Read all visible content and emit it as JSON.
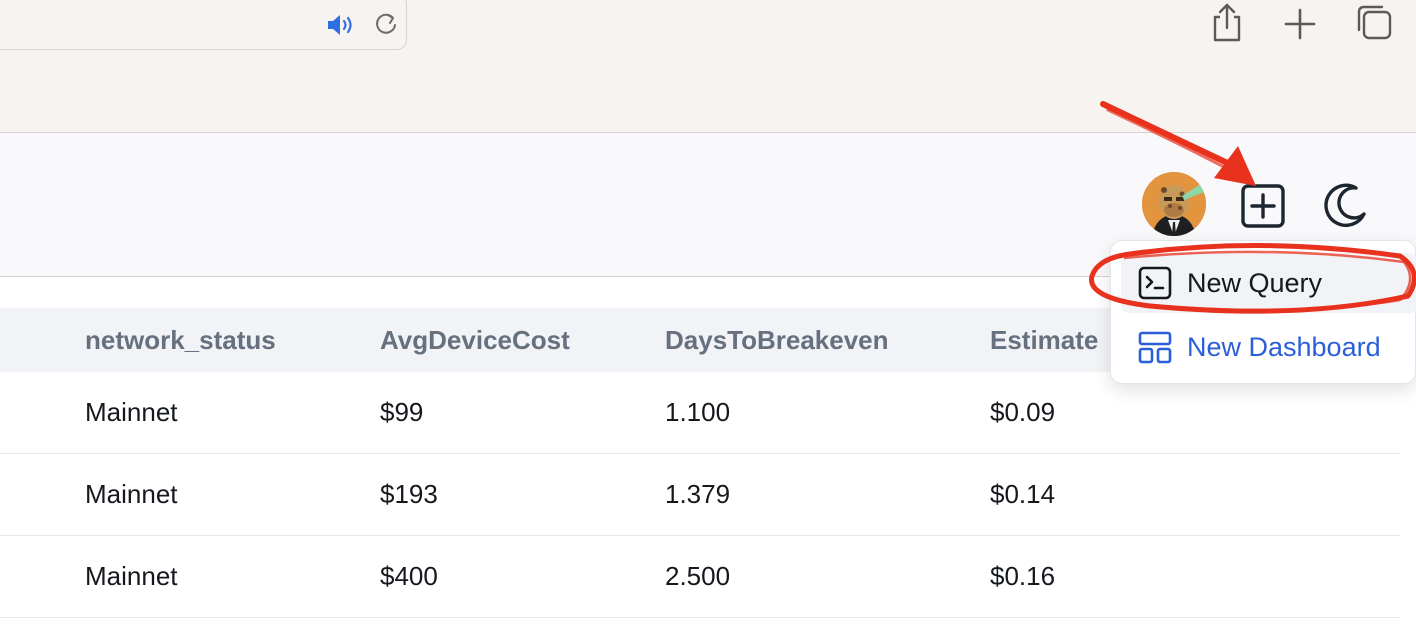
{
  "browser": {
    "address_bar_icons": [
      "speaker-icon",
      "reload-icon"
    ],
    "toolbar_buttons": [
      "share-icon",
      "new-tab-icon",
      "tabs-overview-icon"
    ]
  },
  "header": {
    "avatar_icon": "ape-avatar",
    "new_button_icon": "plus-square-icon",
    "theme_toggle_icon": "moon-icon"
  },
  "dropdown": {
    "items": [
      {
        "label": "New Query",
        "icon": "terminal-icon",
        "color": "#15181d",
        "active": true
      },
      {
        "label": "New Dashboard",
        "icon": "dashboard-layout-icon",
        "color": "#2b5fd9",
        "active": false
      }
    ]
  },
  "table": {
    "columns": [
      "network_status",
      "AvgDeviceCost",
      "DaysToBreakeven",
      "Estimate"
    ],
    "rows": [
      [
        "Mainnet",
        "$99",
        "1.100",
        "$0.09"
      ],
      [
        "Mainnet",
        "$193",
        "1.379",
        "$0.14"
      ],
      [
        "Mainnet",
        "$400",
        "2.500",
        "$0.16"
      ]
    ]
  },
  "colors": {
    "chrome_bg": "#f7f3f1",
    "header_bg": "#f9f9fb",
    "table_head_bg": "#f1f3f6",
    "link_blue": "#2b5fd9",
    "annotation_red": "#e8321e",
    "speaker_blue": "#2f6fe0"
  }
}
